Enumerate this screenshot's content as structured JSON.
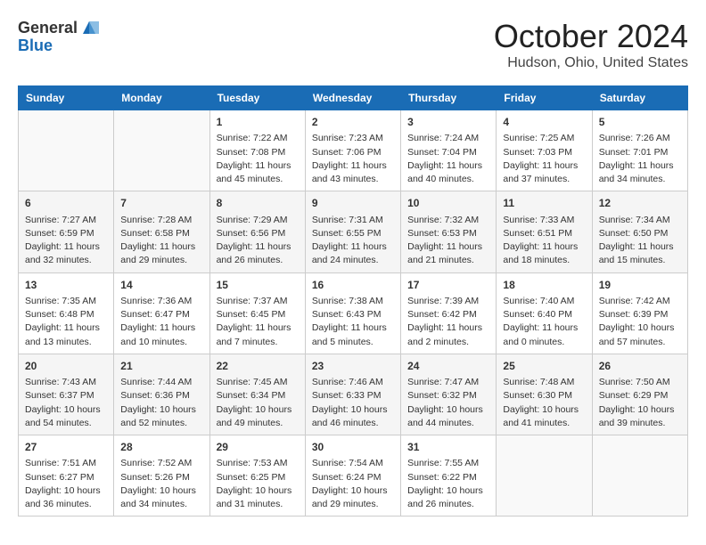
{
  "header": {
    "logo_general": "General",
    "logo_blue": "Blue",
    "month": "October 2024",
    "location": "Hudson, Ohio, United States"
  },
  "columns": [
    "Sunday",
    "Monday",
    "Tuesday",
    "Wednesday",
    "Thursday",
    "Friday",
    "Saturday"
  ],
  "weeks": [
    [
      {
        "day": "",
        "detail": ""
      },
      {
        "day": "",
        "detail": ""
      },
      {
        "day": "1",
        "detail": "Sunrise: 7:22 AM\nSunset: 7:08 PM\nDaylight: 11 hours and 45 minutes."
      },
      {
        "day": "2",
        "detail": "Sunrise: 7:23 AM\nSunset: 7:06 PM\nDaylight: 11 hours and 43 minutes."
      },
      {
        "day": "3",
        "detail": "Sunrise: 7:24 AM\nSunset: 7:04 PM\nDaylight: 11 hours and 40 minutes."
      },
      {
        "day": "4",
        "detail": "Sunrise: 7:25 AM\nSunset: 7:03 PM\nDaylight: 11 hours and 37 minutes."
      },
      {
        "day": "5",
        "detail": "Sunrise: 7:26 AM\nSunset: 7:01 PM\nDaylight: 11 hours and 34 minutes."
      }
    ],
    [
      {
        "day": "6",
        "detail": "Sunrise: 7:27 AM\nSunset: 6:59 PM\nDaylight: 11 hours and 32 minutes."
      },
      {
        "day": "7",
        "detail": "Sunrise: 7:28 AM\nSunset: 6:58 PM\nDaylight: 11 hours and 29 minutes."
      },
      {
        "day": "8",
        "detail": "Sunrise: 7:29 AM\nSunset: 6:56 PM\nDaylight: 11 hours and 26 minutes."
      },
      {
        "day": "9",
        "detail": "Sunrise: 7:31 AM\nSunset: 6:55 PM\nDaylight: 11 hours and 24 minutes."
      },
      {
        "day": "10",
        "detail": "Sunrise: 7:32 AM\nSunset: 6:53 PM\nDaylight: 11 hours and 21 minutes."
      },
      {
        "day": "11",
        "detail": "Sunrise: 7:33 AM\nSunset: 6:51 PM\nDaylight: 11 hours and 18 minutes."
      },
      {
        "day": "12",
        "detail": "Sunrise: 7:34 AM\nSunset: 6:50 PM\nDaylight: 11 hours and 15 minutes."
      }
    ],
    [
      {
        "day": "13",
        "detail": "Sunrise: 7:35 AM\nSunset: 6:48 PM\nDaylight: 11 hours and 13 minutes."
      },
      {
        "day": "14",
        "detail": "Sunrise: 7:36 AM\nSunset: 6:47 PM\nDaylight: 11 hours and 10 minutes."
      },
      {
        "day": "15",
        "detail": "Sunrise: 7:37 AM\nSunset: 6:45 PM\nDaylight: 11 hours and 7 minutes."
      },
      {
        "day": "16",
        "detail": "Sunrise: 7:38 AM\nSunset: 6:43 PM\nDaylight: 11 hours and 5 minutes."
      },
      {
        "day": "17",
        "detail": "Sunrise: 7:39 AM\nSunset: 6:42 PM\nDaylight: 11 hours and 2 minutes."
      },
      {
        "day": "18",
        "detail": "Sunrise: 7:40 AM\nSunset: 6:40 PM\nDaylight: 11 hours and 0 minutes."
      },
      {
        "day": "19",
        "detail": "Sunrise: 7:42 AM\nSunset: 6:39 PM\nDaylight: 10 hours and 57 minutes."
      }
    ],
    [
      {
        "day": "20",
        "detail": "Sunrise: 7:43 AM\nSunset: 6:37 PM\nDaylight: 10 hours and 54 minutes."
      },
      {
        "day": "21",
        "detail": "Sunrise: 7:44 AM\nSunset: 6:36 PM\nDaylight: 10 hours and 52 minutes."
      },
      {
        "day": "22",
        "detail": "Sunrise: 7:45 AM\nSunset: 6:34 PM\nDaylight: 10 hours and 49 minutes."
      },
      {
        "day": "23",
        "detail": "Sunrise: 7:46 AM\nSunset: 6:33 PM\nDaylight: 10 hours and 46 minutes."
      },
      {
        "day": "24",
        "detail": "Sunrise: 7:47 AM\nSunset: 6:32 PM\nDaylight: 10 hours and 44 minutes."
      },
      {
        "day": "25",
        "detail": "Sunrise: 7:48 AM\nSunset: 6:30 PM\nDaylight: 10 hours and 41 minutes."
      },
      {
        "day": "26",
        "detail": "Sunrise: 7:50 AM\nSunset: 6:29 PM\nDaylight: 10 hours and 39 minutes."
      }
    ],
    [
      {
        "day": "27",
        "detail": "Sunrise: 7:51 AM\nSunset: 6:27 PM\nDaylight: 10 hours and 36 minutes."
      },
      {
        "day": "28",
        "detail": "Sunrise: 7:52 AM\nSunset: 5:26 PM\nDaylight: 10 hours and 34 minutes."
      },
      {
        "day": "29",
        "detail": "Sunrise: 7:53 AM\nSunset: 6:25 PM\nDaylight: 10 hours and 31 minutes."
      },
      {
        "day": "30",
        "detail": "Sunrise: 7:54 AM\nSunset: 6:24 PM\nDaylight: 10 hours and 29 minutes."
      },
      {
        "day": "31",
        "detail": "Sunrise: 7:55 AM\nSunset: 6:22 PM\nDaylight: 10 hours and 26 minutes."
      },
      {
        "day": "",
        "detail": ""
      },
      {
        "day": "",
        "detail": ""
      }
    ]
  ]
}
